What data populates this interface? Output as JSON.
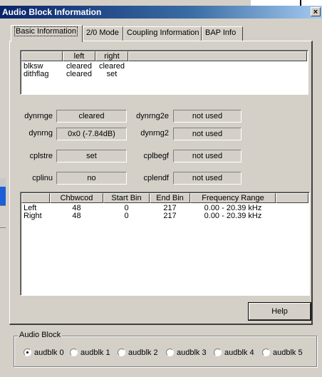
{
  "window": {
    "title": "Audio Block Information",
    "close_glyph": "×"
  },
  "tabs": [
    {
      "label": "Basic Information",
      "active": true
    },
    {
      "label": "2/0 Mode",
      "active": false
    },
    {
      "label": "Coupling Information",
      "active": false
    },
    {
      "label": "BAP Info",
      "active": false
    }
  ],
  "flags_table": {
    "headers": [
      "",
      "left",
      "right"
    ],
    "rows": [
      {
        "name": "blksw",
        "left": "cleared",
        "right": "cleared"
      },
      {
        "name": "dithflag",
        "left": "cleared",
        "right": "set"
      }
    ]
  },
  "fields": {
    "dynrnge": {
      "label": "dynrnge",
      "value": "cleared"
    },
    "dynrng": {
      "label": "dynrng",
      "value": "0x0 (-7.84dB)"
    },
    "cplstre": {
      "label": "cplstre",
      "value": "set"
    },
    "cplinu": {
      "label": "cplinu",
      "value": "no"
    },
    "dynrng2e": {
      "label": "dynrng2e",
      "value": "not used"
    },
    "dynrng2": {
      "label": "dynrng2",
      "value": "not used"
    },
    "cplbegf": {
      "label": "cplbegf",
      "value": "not used"
    },
    "cplendf": {
      "label": "cplendf",
      "value": "not used"
    }
  },
  "channel_table": {
    "headers": [
      "",
      "Chbwcod",
      "Start Bin",
      "End Bin",
      "Frequency Range"
    ],
    "rows": [
      {
        "channel": "Left",
        "chbwcod": "48",
        "start_bin": "0",
        "end_bin": "217",
        "freq_range": "0.00 - 20.39 kHz"
      },
      {
        "channel": "Right",
        "chbwcod": "48",
        "start_bin": "0",
        "end_bin": "217",
        "freq_range": "0.00 - 20.39 kHz"
      }
    ]
  },
  "help_button": {
    "label": "Help"
  },
  "audio_block": {
    "title": "Audio Block",
    "options": [
      "audblk 0",
      "audblk 1",
      "audblk 2",
      "audblk 3",
      "audblk 4",
      "audblk 5"
    ],
    "selected": "audblk 0"
  }
}
